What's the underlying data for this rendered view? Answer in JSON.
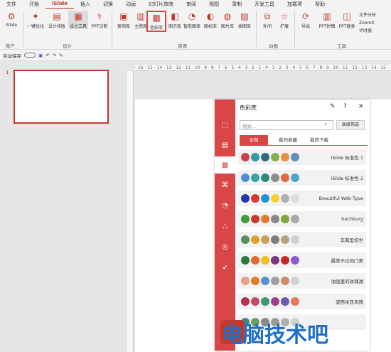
{
  "menu": [
    "文件",
    "开始",
    "iSlide",
    "插入",
    "切换",
    "动画",
    "幻灯片放映",
    "审阅",
    "视图",
    "录制",
    "开发工具",
    "加载项",
    "帮助"
  ],
  "ribbon": {
    "items": [
      {
        "label": "iSlide",
        "icon": "gear-icon"
      },
      {
        "label": "一键优化",
        "icon": "wand-icon"
      },
      {
        "label": "设计排版",
        "icon": "layout-icon"
      },
      {
        "label": "设计工具",
        "icon": "tools-icon"
      },
      {
        "label": "PPT诊断",
        "icon": "diagnose-icon"
      },
      {
        "label": "案例库",
        "icon": "case-icon"
      },
      {
        "label": "主题库",
        "icon": "theme-icon"
      },
      {
        "label": "色彩库",
        "icon": "palette-icon"
      },
      {
        "label": "图示库",
        "icon": "diagram-icon"
      },
      {
        "label": "智能图表",
        "icon": "chart-icon"
      },
      {
        "label": "图标库",
        "icon": "icon-icon"
      },
      {
        "label": "图片库",
        "icon": "picture-icon"
      },
      {
        "label": "插图库",
        "icon": "illustration-icon"
      },
      {
        "label": "补间",
        "icon": "tween-icon"
      },
      {
        "label": "扩展",
        "icon": "star-icon"
      },
      {
        "label": "导出",
        "icon": "export-icon"
      },
      {
        "label": "PPT拼图",
        "icon": "puzzle-icon"
      },
      {
        "label": "PPT瘦身",
        "icon": "slim-icon"
      }
    ],
    "small": [
      "文件分析",
      "ZoomIt",
      "计时器"
    ],
    "groups": [
      "账户",
      "设计",
      "资源",
      "动画",
      "工具"
    ]
  },
  "toolbar2": {
    "autosave": "自动保存"
  },
  "slide_number": "1",
  "ruler": "· 16 · 15 · 14 · 13 · 12 · 11 · 10 · 9 · 8 · 7 · 6 · 5 · 4 · 3 · 2 · 1 · 0 · 1 · 2 · 3 · 4 · 5 · 6 · 7 · 8 · 9 · 10 · 11 · 12 · 13 · 14 · 15 · 16",
  "panel": {
    "title": "色彩库",
    "search_placeholder": "搜索...",
    "filter": "高级筛选",
    "tabs": [
      "全部",
      "我的收藏",
      "我的下载"
    ],
    "rows": [
      {
        "name": "iSlide 标准色 1",
        "colors": [
          "#c9404b",
          "#2f9ba0",
          "#2c6c7a",
          "#7fb24a",
          "#e6923a",
          "#5f8fb9"
        ]
      },
      {
        "name": "iSlide 标准色 2",
        "colors": [
          "#4f8fd0",
          "#3aa3a6",
          "#2e8a7f",
          "#8c8c8c",
          "#e06a3a",
          "#4aa9c9"
        ]
      },
      {
        "name": "Beautiful Web Type",
        "colors": [
          "#2435b0",
          "#d43a30",
          "#1e95d8",
          "#f4d42a",
          "#b0b0b0",
          "#dcdcdc"
        ]
      },
      {
        "name": "hochburg",
        "colors": [
          "#3f9a3a",
          "#c83a2f",
          "#e27a30",
          "#888888",
          "#7fa640",
          "#a8a8a8"
        ]
      },
      {
        "name": "非典型炫世",
        "colors": [
          "#5a8f5c",
          "#e0a030",
          "#c9a05a",
          "#7d7d7d",
          "#b8a080",
          "#d0d0d0"
        ]
      },
      {
        "name": "最美不过闷门美",
        "colors": [
          "#2c7a3e",
          "#e36a30",
          "#f0c020",
          "#7c3a7e",
          "#c02a2a",
          "#8a5ad0"
        ]
      },
      {
        "name": "油画里的玫瑰湖",
        "colors": [
          "#e8a080",
          "#e27a30",
          "#5a8fd0",
          "#a0a0a0",
          "#d08a6a",
          "#d0d0d0"
        ]
      },
      {
        "name": "波西米亚风情",
        "colors": [
          "#b2304a",
          "#c04a6a",
          "#3a9a6a",
          "#a03a8a",
          "#6a5ab0",
          "#e07a5a"
        ]
      },
      {
        "name": "",
        "colors": [
          "#3a8a8a",
          "#6aa05a",
          "#8a8a8a",
          "#9a9a9a",
          "#b0b0b0",
          "#d0d0d0"
        ]
      }
    ]
  },
  "watermark": "电脑技术吧"
}
